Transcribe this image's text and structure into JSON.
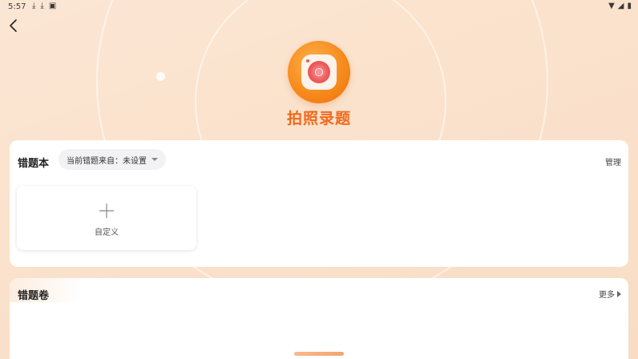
{
  "status_bar": {
    "time": "5:57",
    "left_icons": [
      "download-icon",
      "download-icon",
      "keyboard-a-icon"
    ],
    "right_icons": [
      "wifi-icon",
      "signal-icon",
      "battery-icon"
    ]
  },
  "header": {
    "back_icon": "chevron-left-icon",
    "logo_icon": "camera-icon",
    "title": "拍照录题"
  },
  "notebook_section": {
    "title": "错题本",
    "source_selector_label": "当前错题来自：未设置",
    "manage_label": "管理",
    "custom_tile": {
      "icon": "plus-icon",
      "label": "自定义"
    }
  },
  "paper_section": {
    "title": "错题卷",
    "more_label": "更多"
  },
  "colors": {
    "accent": "#ef6a1c",
    "background": "#fbe4cf",
    "card": "#ffffff"
  }
}
